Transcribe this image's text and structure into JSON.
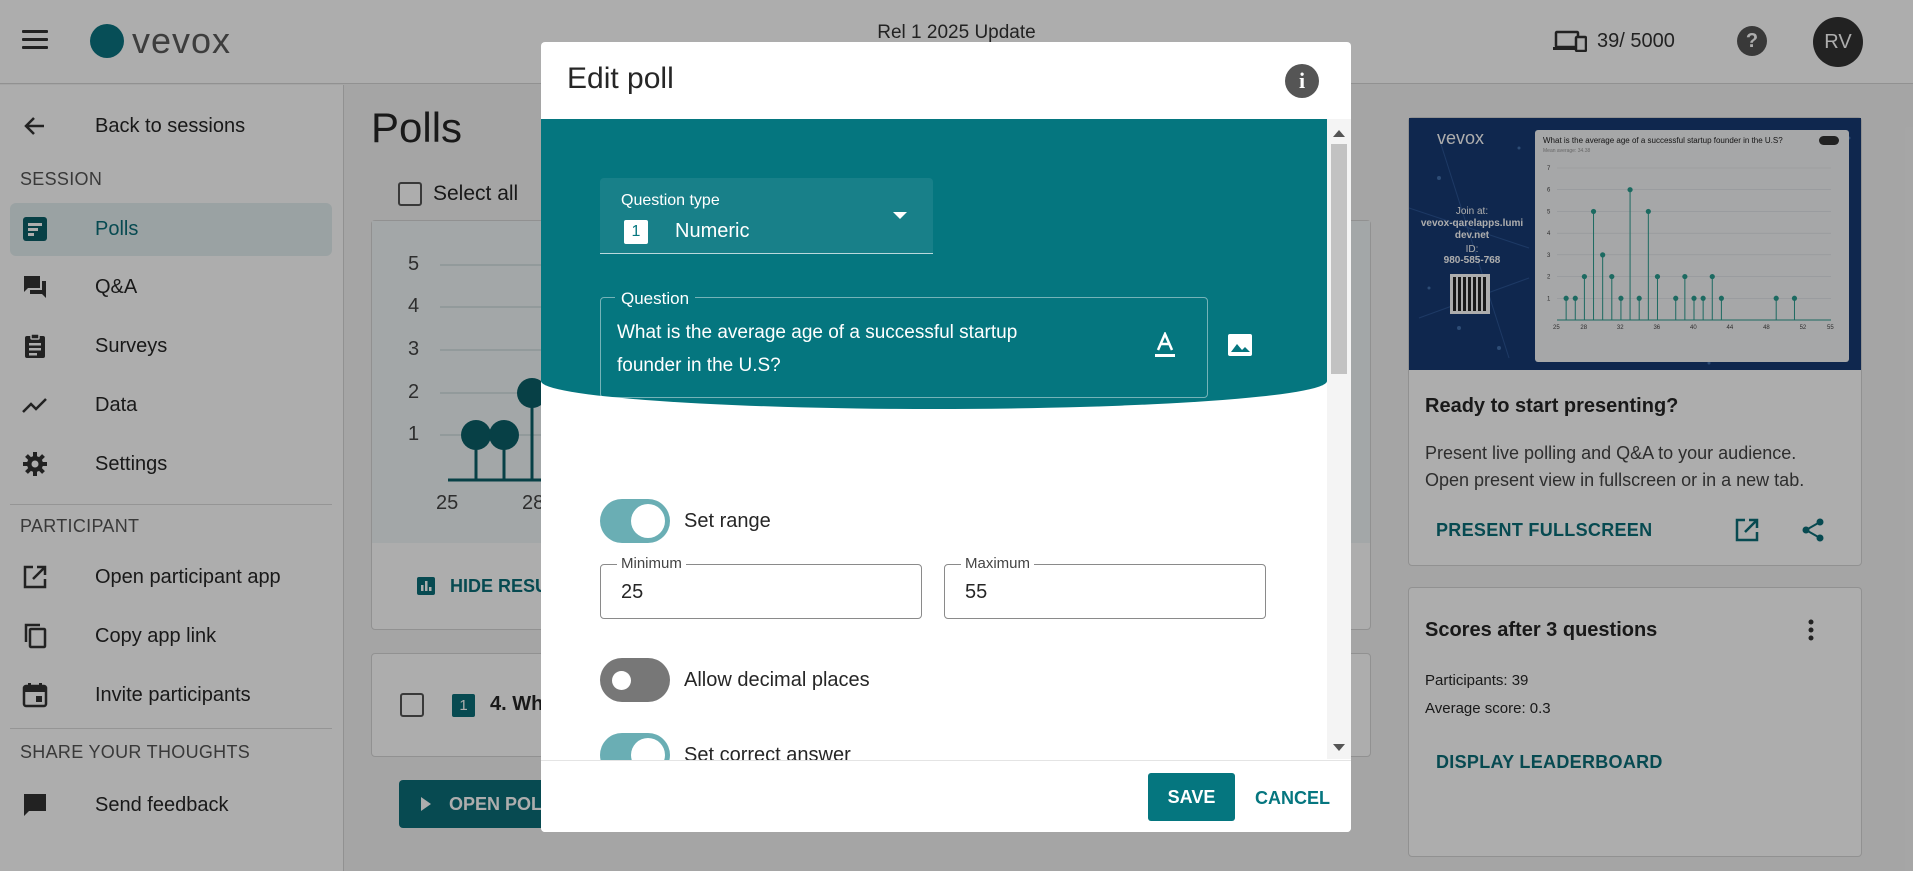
{
  "header": {
    "brand": "vevox",
    "session_title": "Rel 1 2025 Update",
    "participant_count": "39/ 5000",
    "help": "?",
    "avatar": "RV"
  },
  "sidebar": {
    "back": "Back to sessions",
    "session_heading": "SESSION",
    "session_items": [
      {
        "label": "Polls",
        "icon": "polls-icon"
      },
      {
        "label": "Q&A",
        "icon": "qa-icon"
      },
      {
        "label": "Surveys",
        "icon": "surveys-icon"
      },
      {
        "label": "Data",
        "icon": "data-icon"
      },
      {
        "label": "Settings",
        "icon": "gear-icon"
      }
    ],
    "participant_heading": "PARTICIPANT",
    "participant_items": [
      {
        "label": "Open participant app",
        "icon": "open-external-icon"
      },
      {
        "label": "Copy app link",
        "icon": "copy-icon"
      },
      {
        "label": "Invite participants",
        "icon": "calendar-icon"
      }
    ],
    "feedback_heading": "SHARE YOUR THOUGHTS",
    "feedback_item": {
      "label": "Send feedback",
      "icon": "feedback-icon"
    }
  },
  "main": {
    "title": "Polls",
    "select_all": "Select all",
    "mini_chart": {
      "y_ticks": [
        "5",
        "4",
        "3",
        "2",
        "1"
      ],
      "x_ticks": [
        "25",
        "28"
      ]
    },
    "hide_results": "HIDE RESU",
    "poll4_badge": "1",
    "poll4_text": "4. Wh",
    "open_poll": "OPEN POL"
  },
  "right": {
    "preview": {
      "brand": "vevox",
      "join_text": "Join at:",
      "join_url": "vevox-qarelapps.lumi dev.net",
      "id_label": "ID:",
      "id_value": "980-585-768",
      "chart_title": "What is the average age of a successful startup founder in the U.S?",
      "chart_sub": "Mean average: 34.38"
    },
    "ready_title": "Ready to start presenting?",
    "ready_desc": "Present live polling and Q&A to your audience. Open present view in fullscreen or in a new tab.",
    "present_fullscreen": "PRESENT FULLSCREEN",
    "scores_title": "Scores after 3 questions",
    "participants": "Participants: 39",
    "avg_score": "Average score: 0.3",
    "display_leaderboard": "DISPLAY LEADERBOARD"
  },
  "modal": {
    "title": "Edit poll",
    "question_type_label": "Question type",
    "question_type_badge": "1",
    "question_type_value": "Numeric",
    "question_label": "Question",
    "question_text": "What is the average age of a successful startup founder in the U.S?",
    "set_range": "Set range",
    "set_range_on": true,
    "minimum_label": "Minimum",
    "minimum_value": "25",
    "maximum_label": "Maximum",
    "maximum_value": "55",
    "allow_decimals": "Allow decimal places",
    "allow_decimals_on": false,
    "set_correct": "Set correct answer",
    "set_correct_on": true,
    "save": "SAVE",
    "cancel": "CANCEL"
  },
  "chart_data": {
    "type": "scatter",
    "title": "What is the average age of a successful startup founder in the U.S?",
    "x_ticks": [
      25,
      28,
      32,
      36,
      40,
      44,
      48,
      52,
      55
    ],
    "y_ticks": [
      1,
      2,
      3,
      4,
      5,
      6,
      7
    ],
    "xlim": [
      25,
      55
    ],
    "ylim": [
      0,
      7
    ],
    "points": [
      [
        26,
        1
      ],
      [
        27,
        1
      ],
      [
        28,
        2
      ],
      [
        29,
        5
      ],
      [
        30,
        3
      ],
      [
        31,
        2
      ],
      [
        32,
        1
      ],
      [
        33,
        6
      ],
      [
        34,
        1
      ],
      [
        35,
        5
      ],
      [
        36,
        2
      ],
      [
        38,
        1
      ],
      [
        39,
        2
      ],
      [
        40,
        1
      ],
      [
        41,
        1
      ],
      [
        42,
        2
      ],
      [
        43,
        1
      ],
      [
        49,
        1
      ],
      [
        51,
        1
      ]
    ]
  }
}
